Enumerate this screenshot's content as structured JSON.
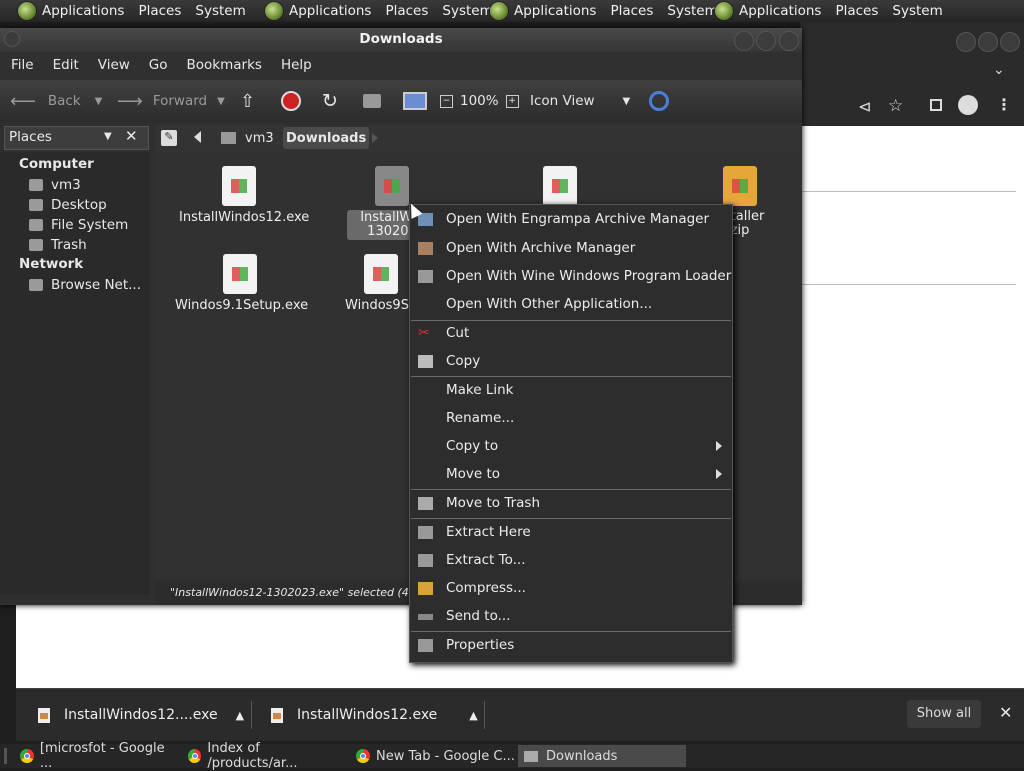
{
  "top_panel": {
    "groups": [
      {
        "applications": "Applications",
        "places": "Places",
        "system": "System"
      },
      {
        "applications": "Applications",
        "places": "Places",
        "system": "System"
      },
      {
        "applications": "Applications",
        "places": "Places",
        "system": "System"
      },
      {
        "applications": "Applications",
        "places": "Places",
        "system": "System"
      }
    ]
  },
  "file_manager": {
    "title": "Downloads",
    "menu": [
      "File",
      "Edit",
      "View",
      "Go",
      "Bookmarks",
      "Help"
    ],
    "toolbar": {
      "back": "Back",
      "forward": "Forward",
      "zoom": "100%",
      "view_mode": "Icon View"
    },
    "sidebar": {
      "header": "Places",
      "computer_heading": "Computer",
      "computer_items": [
        "vm3",
        "Desktop",
        "File System",
        "Trash"
      ],
      "network_heading": "Network",
      "network_items": [
        "Browse Net..."
      ]
    },
    "path": [
      "vm3",
      "Downloads"
    ],
    "files": [
      {
        "name": "InstallWindos12.exe"
      },
      {
        "name": "InstallWindos12-1302023.exe",
        "line1": "InstallWin",
        "line2": "130202"
      },
      {
        "name": "",
        "line1": "",
        "line2": ""
      },
      {
        "name": "Installer.zip",
        "line1": "nstaller",
        "line2": "zip"
      },
      {
        "name": "Windos9.1Setup.exe"
      },
      {
        "name": "Windos9Setup.exe",
        "line1": "Windos9Se"
      }
    ],
    "status": "\"InstallWindos12-1302023.exe\" selected (4.3 MB),"
  },
  "context_menu": {
    "items": [
      {
        "label": "Open With Engrampa Archive Manager",
        "icon": "archive-icon"
      },
      {
        "label": "Open With Archive Manager",
        "icon": "archive-icon"
      },
      {
        "label": "Open With Wine Windows Program Loader",
        "icon": "wine-icon"
      },
      {
        "label": "Open With Other Application...",
        "icon": ""
      },
      {
        "label": "Cut",
        "icon": "scissors-icon"
      },
      {
        "label": "Copy",
        "icon": "copy-icon"
      },
      {
        "label": "Make Link",
        "icon": ""
      },
      {
        "label": "Rename...",
        "icon": ""
      },
      {
        "label": "Copy to",
        "icon": "",
        "submenu": true
      },
      {
        "label": "Move to",
        "icon": "",
        "submenu": true
      },
      {
        "label": "Move to Trash",
        "icon": "trash-icon"
      },
      {
        "label": "Extract Here",
        "icon": "extract-icon"
      },
      {
        "label": "Extract To...",
        "icon": "extract-icon"
      },
      {
        "label": "Compress...",
        "icon": "compress-icon"
      },
      {
        "label": "Send to...",
        "icon": "send-icon"
      },
      {
        "label": "Properties",
        "icon": "properties-icon"
      }
    ]
  },
  "downloads_bar": {
    "items": [
      "InstallWindos12....exe",
      "InstallWindos12.exe"
    ],
    "show_all": "Show all"
  },
  "taskbar": {
    "items": [
      "[microsfot - Google ...",
      "Index of /products/ar...",
      "New Tab - Google C...",
      "Downloads"
    ]
  }
}
